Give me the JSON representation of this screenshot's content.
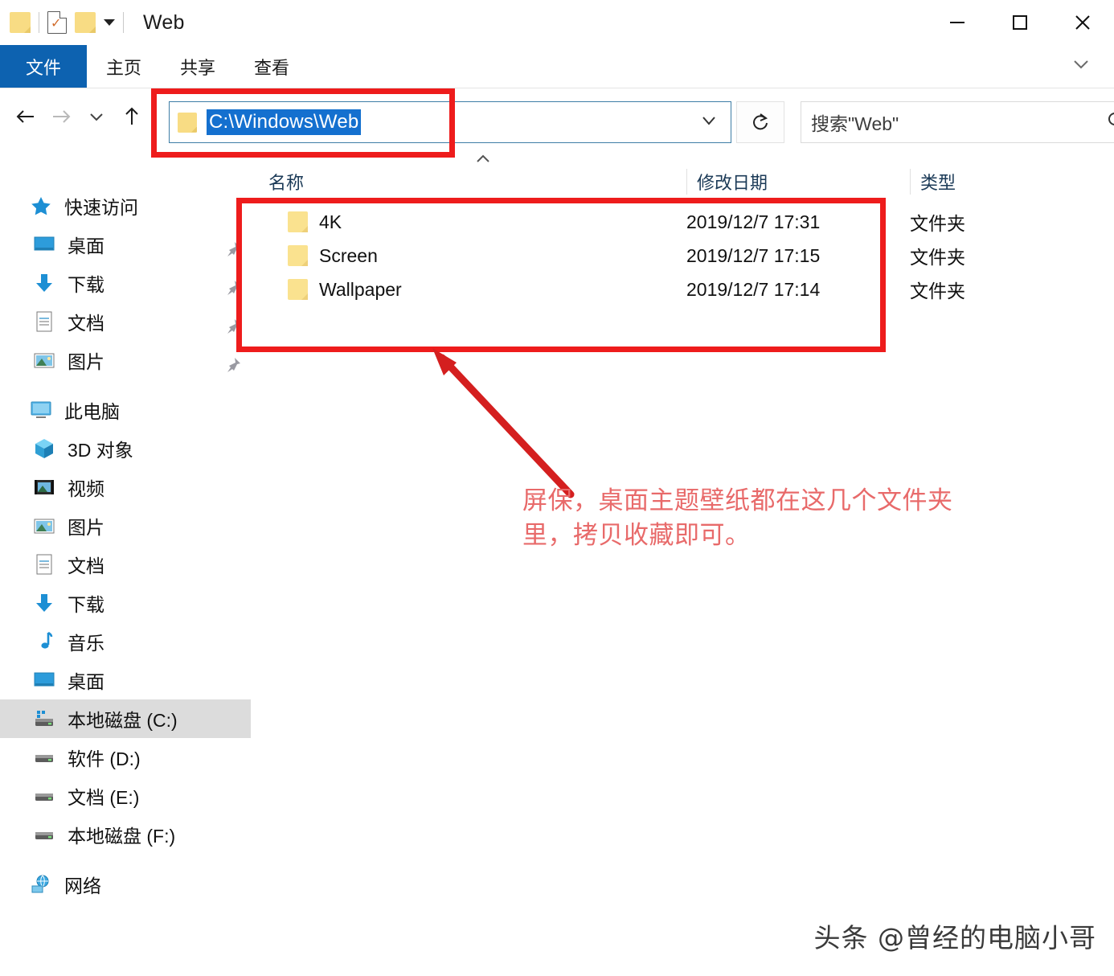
{
  "window": {
    "title": "Web",
    "quick_access_icons": [
      "folder-icon",
      "document-check-icon",
      "folder-icon",
      "dropdown-caret-icon"
    ],
    "controls": {
      "minimize": "–",
      "maximize": "□",
      "close": "✕"
    }
  },
  "ribbon": {
    "tabs": [
      {
        "label": "文件",
        "active": true
      },
      {
        "label": "主页",
        "active": false
      },
      {
        "label": "共享",
        "active": false
      },
      {
        "label": "查看",
        "active": false
      }
    ],
    "expand_icon": "chevron-down-icon"
  },
  "navigation": {
    "back": "←",
    "forward": "→",
    "recent": "⌄",
    "up": "↑"
  },
  "address_bar": {
    "value": "C:\\Windows\\Web",
    "selected": true,
    "dropdown_icon": "chevron-down-icon",
    "refresh_icon": "refresh-icon"
  },
  "search": {
    "placeholder": "搜索\"Web\"",
    "icon": "search-icon"
  },
  "columns": {
    "sort_indicator": "^",
    "headers": [
      "名称",
      "修改日期",
      "类型"
    ]
  },
  "files": [
    {
      "name": "4K",
      "date": "2019/12/7 17:31",
      "type": "文件夹",
      "icon": "folder-icon"
    },
    {
      "name": "Screen",
      "date": "2019/12/7 17:15",
      "type": "文件夹",
      "icon": "folder-icon"
    },
    {
      "name": "Wallpaper",
      "date": "2019/12/7 17:14",
      "type": "文件夹",
      "icon": "folder-icon"
    }
  ],
  "sidebar": {
    "groups": [
      {
        "root": {
          "label": "快速访问",
          "icon": "star-icon"
        },
        "items": [
          {
            "label": "桌面",
            "icon": "desktop-icon",
            "pinned": true
          },
          {
            "label": "下载",
            "icon": "download-icon",
            "pinned": true
          },
          {
            "label": "文档",
            "icon": "documents-icon",
            "pinned": true
          },
          {
            "label": "图片",
            "icon": "pictures-icon",
            "pinned": true
          }
        ]
      },
      {
        "root": {
          "label": "此电脑",
          "icon": "this-pc-icon"
        },
        "items": [
          {
            "label": "3D 对象",
            "icon": "3d-objects-icon",
            "pinned": false
          },
          {
            "label": "视频",
            "icon": "videos-icon",
            "pinned": false
          },
          {
            "label": "图片",
            "icon": "pictures-icon",
            "pinned": false
          },
          {
            "label": "文档",
            "icon": "documents-icon",
            "pinned": false
          },
          {
            "label": "下载",
            "icon": "download-icon",
            "pinned": false
          },
          {
            "label": "音乐",
            "icon": "music-icon",
            "pinned": false
          },
          {
            "label": "桌面",
            "icon": "desktop-icon",
            "pinned": false
          },
          {
            "label": "本地磁盘 (C:)",
            "icon": "system-drive-icon",
            "pinned": false,
            "selected": true
          },
          {
            "label": "软件 (D:)",
            "icon": "drive-icon",
            "pinned": false
          },
          {
            "label": "文档 (E:)",
            "icon": "drive-icon",
            "pinned": false
          },
          {
            "label": "本地磁盘 (F:)",
            "icon": "drive-icon",
            "pinned": false
          }
        ]
      },
      {
        "root": {
          "label": "网络",
          "icon": "network-icon"
        },
        "items": []
      }
    ]
  },
  "annotations": {
    "note_line1": "屏保，桌面主题壁纸都在这几个文件夹",
    "note_line2": "里，拷贝收藏即可。",
    "highlight_color": "#ee1c1c",
    "note_color": "#e86a6a",
    "arrow": "red-arrow-icon"
  },
  "watermark": {
    "text": "头条 @曾经的电脑小哥"
  }
}
